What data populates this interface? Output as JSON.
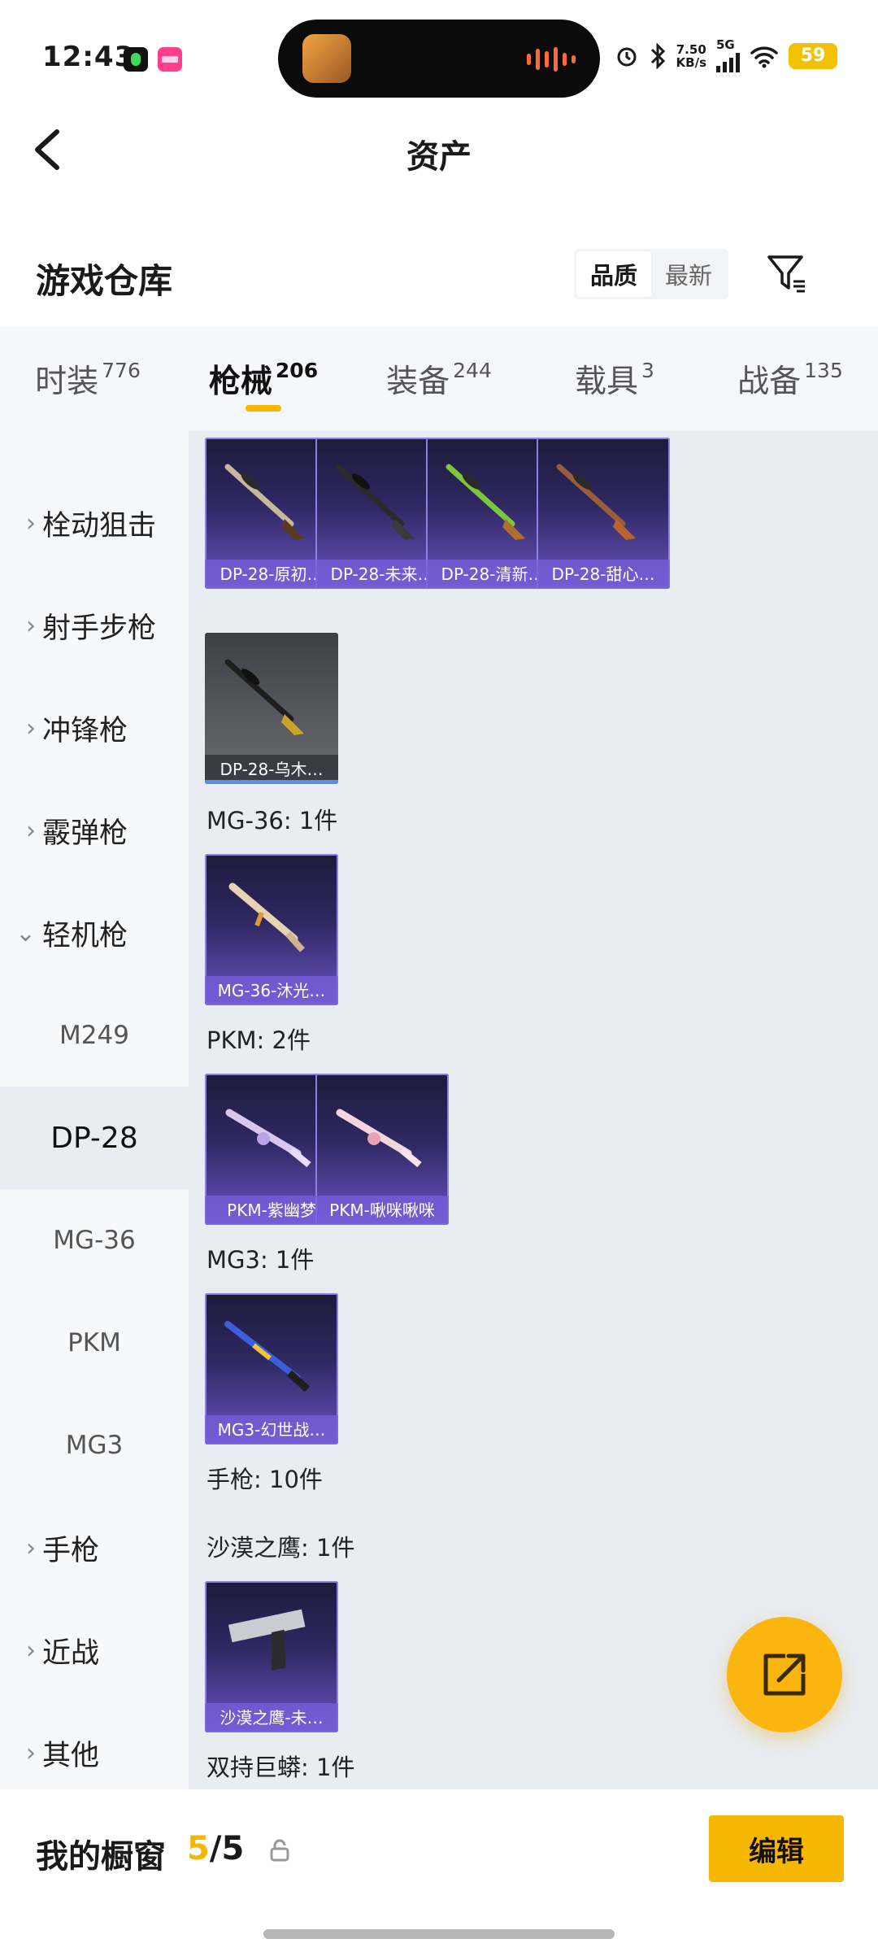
{
  "status_bar": {
    "time": "12:43",
    "net_speed_value": "7.50",
    "net_speed_unit": "KB/s",
    "network": "5G",
    "battery": "59"
  },
  "header": {
    "title": "资产"
  },
  "section": {
    "title": "游戏仓库",
    "sort_quality": "品质",
    "sort_newest": "最新"
  },
  "tabs": [
    {
      "label": "时装",
      "count": "776"
    },
    {
      "label": "枪械",
      "count": "206"
    },
    {
      "label": "装备",
      "count": "244"
    },
    {
      "label": "载具",
      "count": "3"
    },
    {
      "label": "战备",
      "count": "135"
    }
  ],
  "sidebar": {
    "items": [
      {
        "label": "栓动狙击",
        "chevron": "›"
      },
      {
        "label": "射手步枪",
        "chevron": "›"
      },
      {
        "label": "冲锋枪",
        "chevron": "›"
      },
      {
        "label": "霰弹枪",
        "chevron": "›"
      },
      {
        "label": "轻机枪",
        "chevron": "⌄"
      },
      {
        "label": "M249"
      },
      {
        "label": "DP-28"
      },
      {
        "label": "MG-36"
      },
      {
        "label": "PKM"
      },
      {
        "label": "MG3"
      },
      {
        "label": "手枪",
        "chevron": "›"
      },
      {
        "label": "近战",
        "chevron": "›"
      },
      {
        "label": "其他",
        "chevron": "›"
      }
    ]
  },
  "content": {
    "cards": [
      {
        "label": "DP-28-原初…"
      },
      {
        "label": "DP-28-未来…"
      },
      {
        "label": "DP-28-清新…"
      },
      {
        "label": "DP-28-甜心…"
      },
      {
        "label": "DP-28-乌木…"
      },
      {
        "label": "MG-36-沐光…"
      },
      {
        "label": "PKM-紫幽梦"
      },
      {
        "label": "PKM-啾咪啾咪"
      },
      {
        "label": "MG3-幻世战…"
      },
      {
        "label": "沙漠之鹰-未…"
      }
    ],
    "groups": [
      {
        "label": "MG-36: 1件"
      },
      {
        "label": "PKM: 2件"
      },
      {
        "label": "MG3: 1件"
      },
      {
        "label": "手枪: 10件"
      },
      {
        "label": "沙漠之鹰: 1件"
      },
      {
        "label": "双持巨蟒: 1件"
      }
    ]
  },
  "bottom": {
    "title": "我的橱窗",
    "count_current": "5",
    "count_sep": "/",
    "count_total": "5",
    "edit_label": "编辑"
  },
  "colors": {
    "accent": "#f5b700",
    "card_purple": "#6a54c2"
  }
}
